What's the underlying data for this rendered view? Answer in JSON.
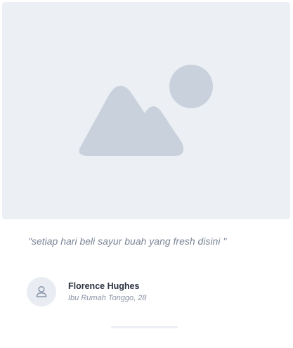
{
  "testimonial": {
    "image_icon": "image-placeholder-icon",
    "quote": "\"setiap hari beli sayur buah yang fresh disini \"",
    "author": {
      "avatar_icon": "user-icon",
      "name": "Florence Hughes",
      "role": "Ibu Rumah Tonggo, 28"
    }
  },
  "colors": {
    "placeholder_bg": "#eceff4",
    "placeholder_shape": "#c9d2dc",
    "quote_text": "#7a8596",
    "name_text": "#2a3140",
    "role_text": "#8a93a3"
  }
}
